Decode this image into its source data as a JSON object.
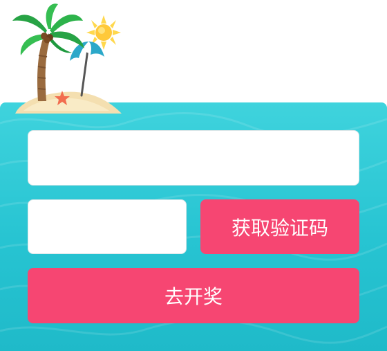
{
  "form": {
    "phone_input": {
      "value": "",
      "placeholder": ""
    },
    "code_input": {
      "value": "",
      "placeholder": ""
    },
    "get_code_label": "获取验证码",
    "draw_label": "去开奖"
  },
  "decoration": {
    "icons": [
      "palm-tree-icon",
      "sun-icon",
      "beach-umbrella-icon",
      "starfish-icon",
      "sand-island-icon"
    ]
  },
  "colors": {
    "panel": "#2fc8d6",
    "accent_button": "#f64672",
    "field_background": "#ffffff",
    "button_text": "#ffffff"
  }
}
